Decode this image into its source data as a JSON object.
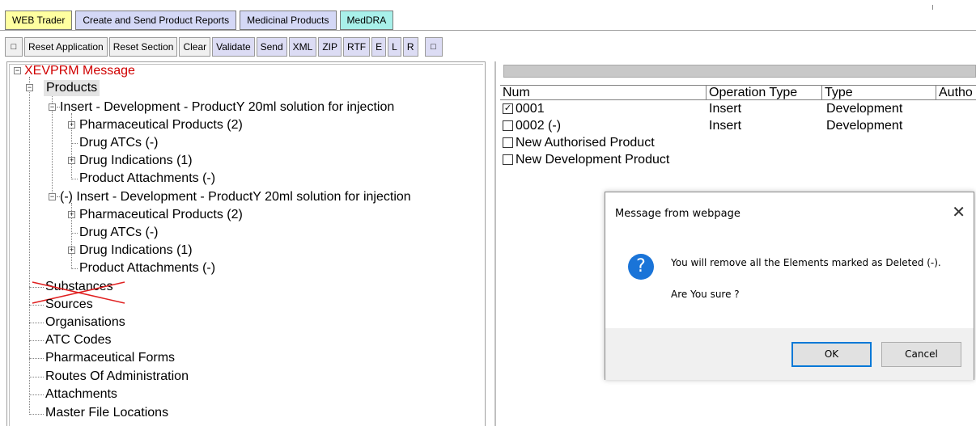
{
  "tabs": [
    "WEB Trader",
    "Create and Send Product Reports",
    "Medicinal Products",
    "MedDRA"
  ],
  "toolbar": {
    "square_left": "□",
    "reset_application": "Reset Application",
    "reset_section": "Reset Section",
    "clear": "Clear",
    "validate": "Validate",
    "send": "Send",
    "xml": "XML",
    "zip": "ZIP",
    "rtf": "RTF",
    "e": "E",
    "l": "L",
    "r": "R",
    "square_right": "□"
  },
  "tree": {
    "root": "XEVPRM Message",
    "products": "Products",
    "product1": "Insert - Development - ProductY 20ml solution for injection",
    "product2": "(-) Insert - Development - ProductY 20ml solution for injection",
    "pharm_products": "Pharmaceutical Products (2)",
    "drug_atcs": "Drug ATCs (-)",
    "drug_indications": "Drug Indications (1)",
    "product_attachments": "Product Attachments (-)",
    "substances": "Substances",
    "sources": "Sources",
    "organisations": "Organisations",
    "atc_codes": "ATC Codes",
    "pharm_forms": "Pharmaceutical Forms",
    "routes": "Routes Of Administration",
    "attachments": "Attachments",
    "master_file": "Master File Locations"
  },
  "grid": {
    "headers": [
      "Num",
      "Operation Type",
      "Type",
      "Autho"
    ],
    "rows": [
      {
        "checked": "✓",
        "num": "0001",
        "op": "Insert",
        "type": "Development"
      },
      {
        "checked": "",
        "num": "0002 (-)",
        "op": "Insert",
        "type": "Development"
      },
      {
        "checked": "",
        "num": "New Authorised Product",
        "op": "",
        "type": ""
      },
      {
        "checked": "",
        "num": "New Development Product",
        "op": "",
        "type": ""
      }
    ]
  },
  "dialog": {
    "title": "Message from webpage",
    "close": "✕",
    "icon": "?",
    "message": "You will remove all the Elements marked as Deleted (-).",
    "question": "Are You sure ?",
    "ok": "OK",
    "cancel": "Cancel"
  },
  "colors": {
    "tab_yellow": "#ffffa0",
    "tab_lavender": "#d4d8f6",
    "tab_cyan": "#a8f0ea",
    "root_red": "#d00000",
    "dialog_icon_blue": "#1a74d8",
    "ok_border": "#0078d7"
  }
}
